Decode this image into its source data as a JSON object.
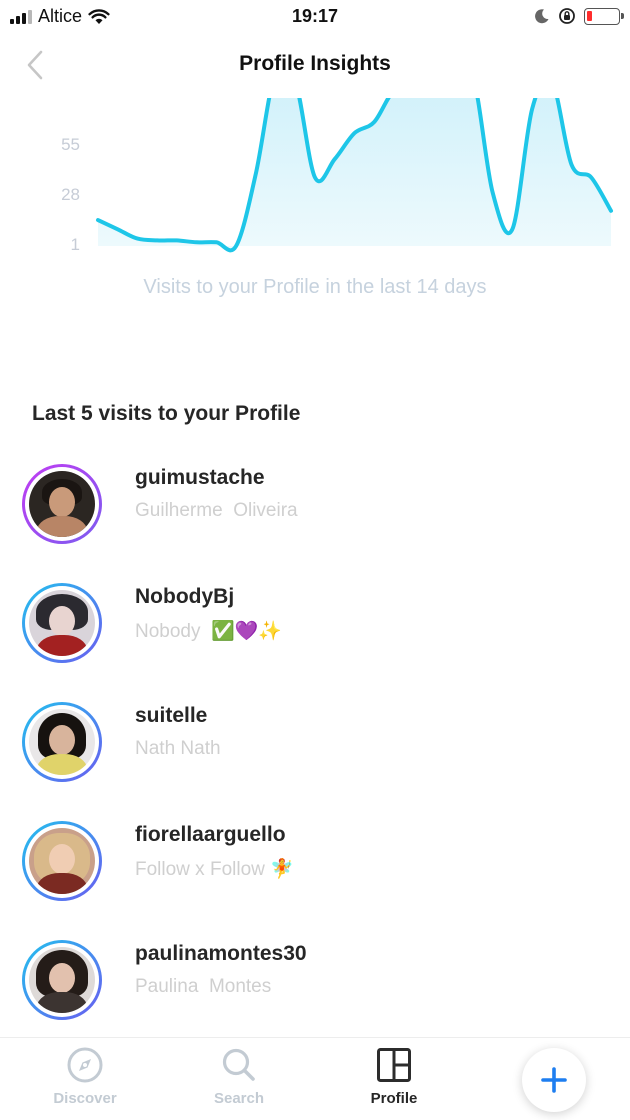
{
  "status_bar": {
    "carrier": "Altice",
    "time": "19:17"
  },
  "header": {
    "title": "Profile Insights"
  },
  "chart_data": {
    "type": "area",
    "title": "",
    "caption": "Visits to your Profile in the last 14 days",
    "yticks": [
      1,
      28,
      55,
      82
    ],
    "ytick_labels": [
      "1",
      "28",
      "55",
      ""
    ],
    "ylim": [
      1,
      82
    ],
    "x": [
      1,
      2,
      3,
      4,
      5,
      6,
      7,
      8,
      9,
      10,
      11,
      12,
      13,
      14,
      15,
      16,
      17,
      18,
      19,
      20,
      21,
      22,
      23,
      24,
      25,
      26,
      27
    ],
    "values": [
      15,
      10,
      5,
      4,
      4,
      3,
      3,
      1,
      40,
      95,
      90,
      38,
      48,
      62,
      68,
      85,
      86,
      88,
      85,
      92,
      30,
      10,
      75,
      90,
      45,
      38,
      20
    ],
    "color": "#1ec6e8",
    "fill": "#cdf0fa"
  },
  "visits": {
    "title": "Last 5 visits to your Profile",
    "items": [
      {
        "username": "guimustache",
        "fullname": "Guilherme  Oliveira",
        "ring": "purple"
      },
      {
        "username": "NobodyBj",
        "fullname": "Nobody  ✅💜✨",
        "ring": "blue"
      },
      {
        "username": "suitelle",
        "fullname": "Nath Nath",
        "ring": "blue"
      },
      {
        "username": "fiorellaarguello",
        "fullname": "Follow x Follow 🧚",
        "ring": "blue"
      },
      {
        "username": "paulinamontes30",
        "fullname": "Paulina  Montes",
        "ring": "blue"
      }
    ]
  },
  "tabs": [
    {
      "label": "Discover",
      "icon": "compass-icon"
    },
    {
      "label": "Search",
      "icon": "search-icon"
    },
    {
      "label": "Profile",
      "icon": "layout-icon"
    }
  ],
  "fab": {
    "icon": "plus-icon"
  }
}
